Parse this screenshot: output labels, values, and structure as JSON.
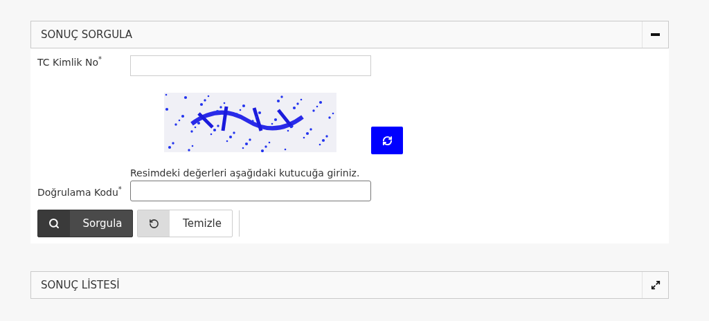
{
  "panels": [
    {
      "title": "SONUÇ SORGULA",
      "collapsed": false,
      "fields": [
        {
          "kind": "text",
          "label": "TC Kimlik No$^{*}$"
        },
        {
          "kind": "captcha"
        },
        {
          "kind": "text",
          "label": "Doğrulama Kodu$^{*}$",
          "hint": "Resimdeki değerleri aşağıdaki kutucuğa giriniz."
        }
      ],
      "buttons": [
        {
          "kind": "primary",
          "label": "Sorgula"
        },
        {
          "kind": "secondary",
          "label": "Temizle"
        }
      ]
    },
    {
      "title": "SONUÇ LİSTESİ",
      "collapsed": true
    }
  ]
}
